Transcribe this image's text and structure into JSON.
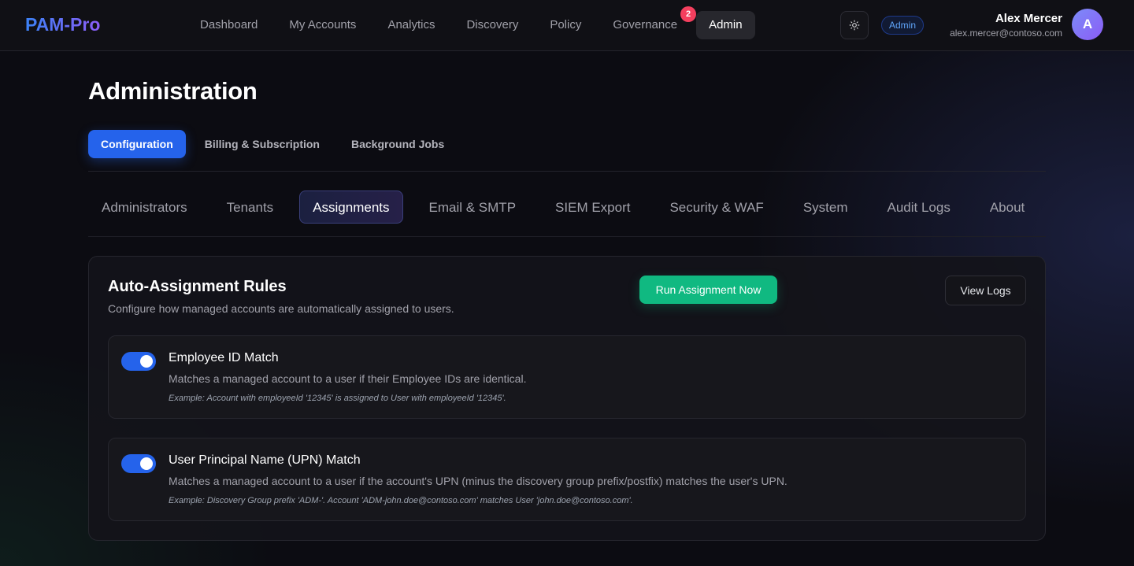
{
  "app": {
    "logo": "PAM-Pro"
  },
  "nav": {
    "items": [
      {
        "label": "Dashboard"
      },
      {
        "label": "My Accounts"
      },
      {
        "label": "Analytics"
      },
      {
        "label": "Discovery"
      },
      {
        "label": "Policy"
      },
      {
        "label": "Governance",
        "badge": "2"
      },
      {
        "label": "Admin",
        "active": true
      }
    ]
  },
  "header": {
    "theme_icon": "sun-icon",
    "role_badge": "Admin",
    "user_name": "Alex Mercer",
    "user_email": "alex.mercer@contoso.com",
    "avatar_initial": "A"
  },
  "page": {
    "title": "Administration",
    "primary_tabs": [
      {
        "label": "Configuration",
        "active": true
      },
      {
        "label": "Billing & Subscription"
      },
      {
        "label": "Background Jobs"
      }
    ],
    "secondary_tabs": [
      {
        "label": "Administrators"
      },
      {
        "label": "Tenants"
      },
      {
        "label": "Assignments",
        "active": true
      },
      {
        "label": "Email & SMTP"
      },
      {
        "label": "SIEM Export"
      },
      {
        "label": "Security & WAF"
      },
      {
        "label": "System"
      },
      {
        "label": "Audit Logs"
      },
      {
        "label": "About"
      }
    ]
  },
  "card": {
    "title": "Auto-Assignment Rules",
    "description": "Configure how managed accounts are automatically assigned to users.",
    "run_button": "Run Assignment Now",
    "logs_button": "View Logs",
    "rules": [
      {
        "enabled": true,
        "title": "Employee ID Match",
        "description": "Matches a managed account to a user if their Employee IDs are identical.",
        "example": "Example: Account with employeeId '12345' is assigned to User with employeeId '12345'."
      },
      {
        "enabled": true,
        "title": "User Principal Name (UPN) Match",
        "description": "Matches a managed account to a user if the account's UPN (minus the discovery group prefix/postfix) matches the user's UPN.",
        "example": "Example: Discovery Group prefix 'ADM-'. Account 'ADM-john.doe@contoso.com' matches User 'john.doe@contoso.com'."
      }
    ]
  },
  "colors": {
    "accent": "#2563eb",
    "success": "#10b981",
    "badge": "#f43f5e",
    "logo_gradient_start": "#3b82f6",
    "logo_gradient_end": "#8b5cf6"
  }
}
